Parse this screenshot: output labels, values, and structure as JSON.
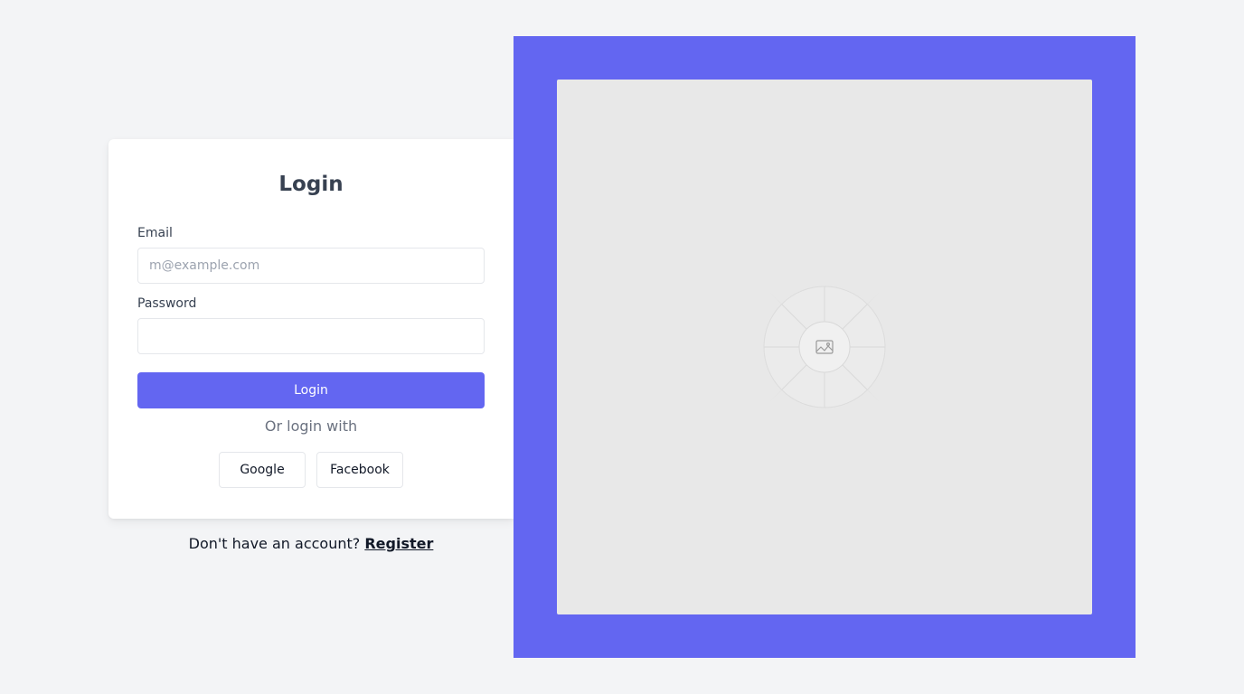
{
  "login": {
    "title": "Login",
    "email_label": "Email",
    "email_placeholder": "m@example.com",
    "email_value": "",
    "password_label": "Password",
    "password_value": "",
    "submit_label": "Login",
    "divider_text": "Or login with",
    "social": {
      "google_label": "Google",
      "facebook_label": "Facebook"
    }
  },
  "register": {
    "prompt": "Don't have an account?",
    "link_label": "Register"
  },
  "image_panel": {
    "icon": "image-icon",
    "accent_color": "#6366f1"
  }
}
